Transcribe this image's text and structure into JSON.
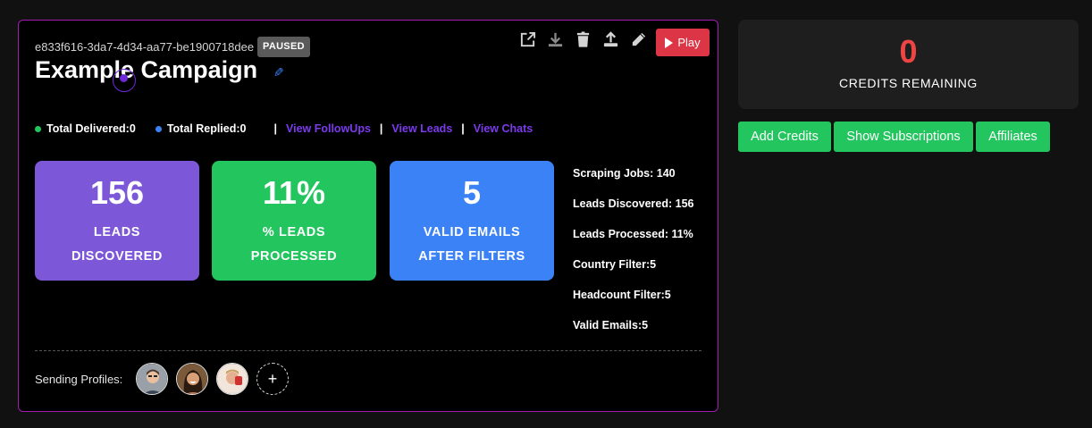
{
  "campaign": {
    "id": "e833f616-3da7-4d34-aa77-be1900718dee",
    "status": "PAUSED",
    "title": "Example Campaign",
    "edit_icon": "pencil-icon"
  },
  "toolbar": {
    "icons": [
      "external-link-icon",
      "download-icon",
      "trash-icon",
      "upload-icon",
      "pencil-icon"
    ],
    "play_label": "Play",
    "play_color": "#dc3545"
  },
  "stats": {
    "delivered_label": "Total Delivered:",
    "delivered_value": "0",
    "delivered_color": "#22c55e",
    "replied_label": "Total Replied:",
    "replied_value": "0",
    "replied_color": "#3b82f6",
    "sep": "|",
    "links": [
      "View FollowUps",
      "View Leads",
      "View Chats"
    ],
    "link_color": "#7c3aed"
  },
  "metrics": [
    {
      "value": "156",
      "line1": "LEADS",
      "line2": "DISCOVERED",
      "color": "#7c57d8"
    },
    {
      "value": "11%",
      "line1": "% LEADS",
      "line2": "PROCESSED",
      "color": "#22c55e"
    },
    {
      "value": "5",
      "line1": "VALID EMAILS",
      "line2": "AFTER FILTERS",
      "color": "#3b82f6"
    }
  ],
  "side_stats": [
    "Scraping Jobs: 140",
    "Leads Discovered: 156",
    "Leads Processed: 11%",
    "Country Filter:5",
    "Headcount Filter:5",
    "Valid Emails:5"
  ],
  "profiles": {
    "label": "Sending Profiles:",
    "add_label": "+"
  },
  "credits": {
    "value": "0",
    "label": "CREDITS REMAINING",
    "value_color": "#ef4444"
  },
  "actions": [
    "Add Credits",
    "Show Subscriptions",
    "Affiliates"
  ],
  "accent_color": "#22c55e"
}
